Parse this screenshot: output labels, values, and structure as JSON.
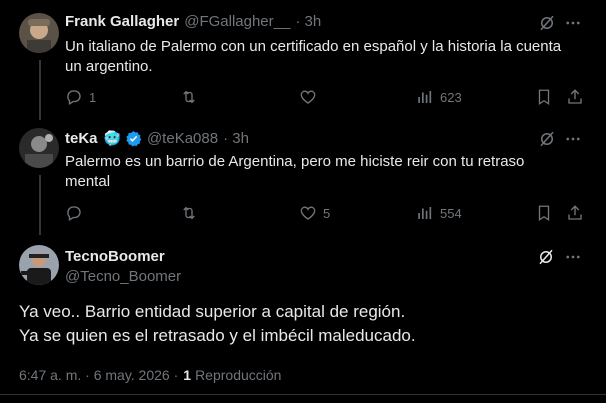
{
  "tweets": [
    {
      "name": "Frank Gallagher",
      "handle": "@FGallagher__",
      "time": "· 3h",
      "text_line1": "Un italiano de Palermo con un certificado en español y la historia la cuenta",
      "text_line2": "un argentino.",
      "replies": "1",
      "retweets": "",
      "likes": "",
      "views": "623",
      "avatar_icon": "avatar-frank"
    },
    {
      "name": "teKa",
      "badge_emoji": "🥶",
      "handle": "@teKa088",
      "time": "· 3h",
      "text_line1": "Palermo es un barrio de Argentina, pero me hiciste reir con tu retraso",
      "text_line2": "mental",
      "replies": "",
      "retweets": "",
      "likes": "5",
      "views": "554",
      "avatar_icon": "avatar-teka"
    }
  ],
  "main_tweet": {
    "name": "TecnoBoomer",
    "handle": "@Tecno_Boomer",
    "text_line1": "Ya veo.. Barrio entidad superior a capital de región.",
    "text_line2": "Ya se quien es el retrasado y el imbécil  maleducado.",
    "timestamp": "6:47 a. m. · 6 may. 2026 ·",
    "repost_count": "1",
    "repost_label": "Reproducción"
  },
  "colors": {
    "background": "#000000",
    "text": "#e7e9ea",
    "muted": "#71767b",
    "verified": "#1d9bf0",
    "divider": "#2f3336"
  }
}
